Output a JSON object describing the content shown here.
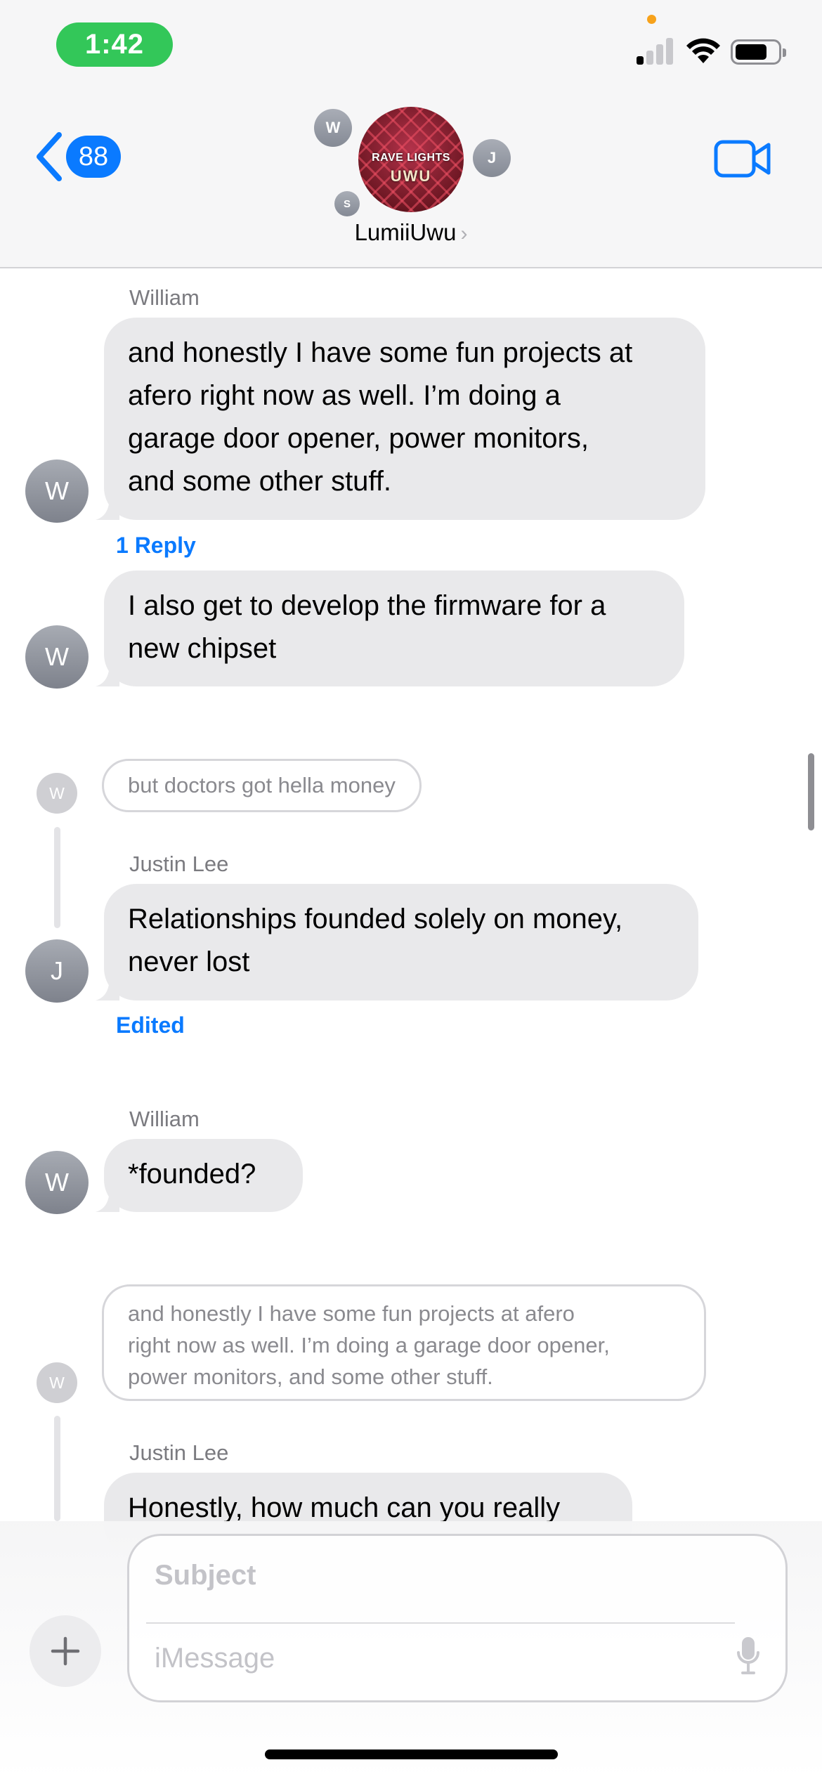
{
  "status_bar": {
    "time": "1:42"
  },
  "header": {
    "back_count": "88",
    "group_name": "LumiiUwu",
    "group_avatar_text_line1": "RAVE LIGHTS",
    "group_avatar_text_line2": "UWU",
    "member_initials": [
      "W",
      "J",
      "S"
    ]
  },
  "messages": [
    {
      "sender": "William",
      "initial": "W",
      "lines": [
        "and honestly I have some fun projects at",
        "afero right now as well. I’m doing a",
        "garage door opener, power monitors,",
        "and some other stuff."
      ],
      "reply_count": "1 Reply"
    },
    {
      "initial": "W",
      "lines": [
        "I also get to develop the firmware for a",
        "new chipset"
      ]
    },
    {
      "quoted_initial": "W",
      "quoted": "but doctors got hella money",
      "sender": "Justin Lee",
      "initial": "J",
      "lines": [
        "Relationships founded solely on money,",
        "never lost"
      ],
      "status": "Edited"
    },
    {
      "sender": "William",
      "initial": "W",
      "lines": [
        "*founded?"
      ]
    },
    {
      "quoted_initial": "W",
      "quoted_lines": [
        "and honestly I have some fun projects at afero",
        "right now as well. I’m doing a garage door opener,",
        "power monitors, and some other stuff."
      ],
      "sender": "Justin Lee",
      "lines": [
        "Honestly, how much can you really"
      ]
    }
  ],
  "composer": {
    "subject_placeholder": "Subject",
    "message_placeholder": "iMessage"
  },
  "icons": [
    "back-chevron-icon",
    "video-camera-icon",
    "plus-icon",
    "microphone-icon",
    "wifi-icon",
    "signal-icon",
    "battery-icon"
  ],
  "colors": {
    "accent": "#0a7aff",
    "bubble": "#e9e9eb",
    "time_pill": "#33c759"
  }
}
